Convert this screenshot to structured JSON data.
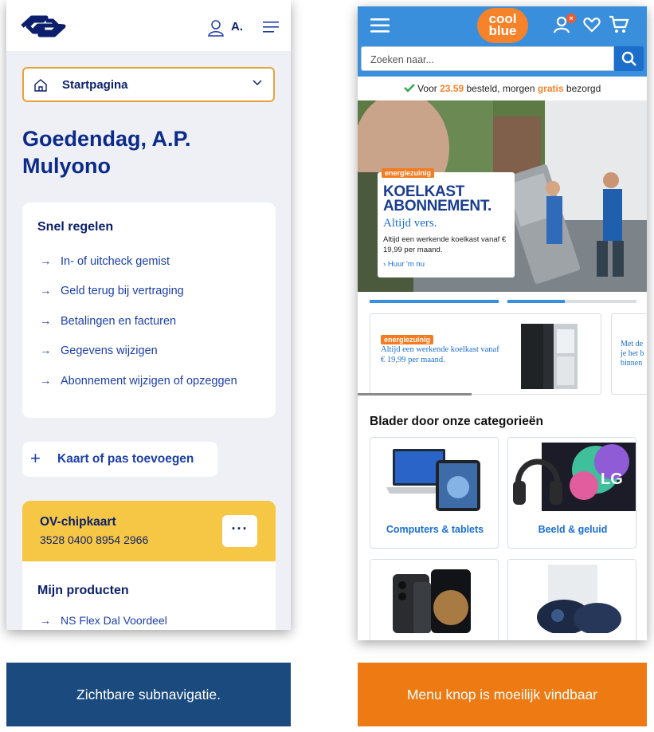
{
  "ns": {
    "user_initial": "A.",
    "select_label": "Startpagina",
    "greeting": "Goedendag, A.P. Mulyono",
    "quick": {
      "title": "Snel regelen",
      "items": [
        "In- of uitcheck gemist",
        "Geld terug bij vertraging",
        "Betalingen en facturen",
        "Gegevens wijzigen",
        "Abonnement wijzigen of opzeggen"
      ]
    },
    "add_card_label": "Kaart of pas toevoegen",
    "ov_card": {
      "title": "OV-chipkaart",
      "number": "3528 0400 8954 2966",
      "more": "···"
    },
    "products": {
      "title": "Mijn producten",
      "item": "NS Flex Dal Voordeel"
    },
    "colors": {
      "navy": "#0b1f6b",
      "blue": "#1c3fa8",
      "yellow": "#f6c744",
      "orange_border": "#e8a23a",
      "bg": "#eef0f5"
    }
  },
  "coolblue": {
    "logo_line1": "cool",
    "logo_line2": "blue",
    "cart_badge": "×",
    "search_placeholder": "Zoeken naar...",
    "delivery": {
      "pre": "Voor",
      "time": "23.59",
      "mid": "besteld, morgen",
      "free": "gratis",
      "post": "bezorgd"
    },
    "hero": {
      "tag": "energiezuinig",
      "title_line1": "KOELKAST",
      "title_line2": "ABONNEMENT.",
      "subtitle": "Altijd vers.",
      "text": "Altijd een werkende koelkast vanaf € 19,99 per maand.",
      "link": "Huur 'm nu"
    },
    "promo": {
      "tag": "energiezuinig",
      "text": "Altijd een werkende koelkast vanaf € 19,99 per maand.",
      "next_line1": "Met de",
      "next_line2": "je het b",
      "next_line3": "binnen"
    },
    "categories_title": "Blader door onze categorieën",
    "categories": [
      "Computers & tablets",
      "Beeld & geluid",
      "",
      ""
    ],
    "colors": {
      "header": "#3a8fdc",
      "orange": "#f6822a",
      "link": "#1a6ed3"
    }
  },
  "captions": {
    "left": "Zichtbare subnavigatie.",
    "right": "Menu knop is moeilijk vindbaar"
  }
}
